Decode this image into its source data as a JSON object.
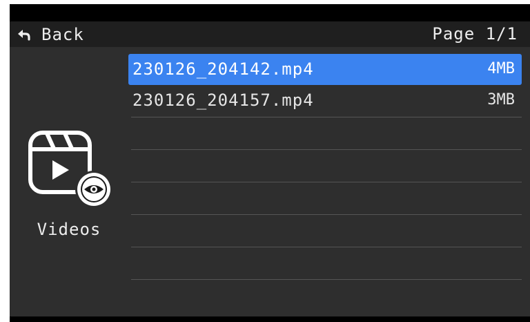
{
  "header": {
    "back_label": "Back",
    "page_indicator": "Page 1/1"
  },
  "category": {
    "label": "Videos",
    "icon": "video-library-view-icon"
  },
  "files": [
    {
      "name": "230126_204142.mp4",
      "size": "4MB",
      "selected": true
    },
    {
      "name": "230126_204157.mp4",
      "size": "3MB",
      "selected": false
    }
  ],
  "colors": {
    "selection": "#3b83f0",
    "header_bg": "#1f1f1f",
    "panel_bg": "#2e2e2e",
    "text": "#ededed"
  }
}
